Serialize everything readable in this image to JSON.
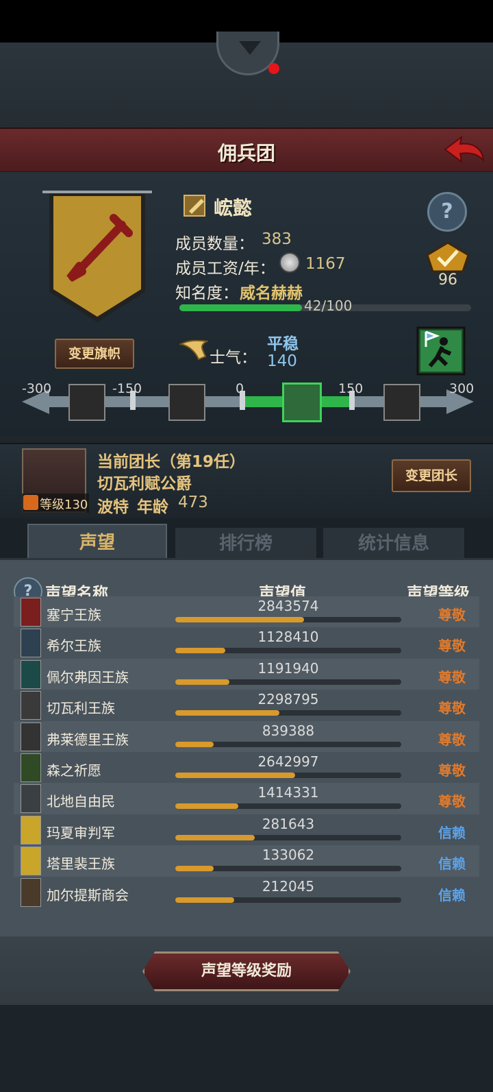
{
  "header": {
    "title": "佣兵团"
  },
  "guild": {
    "name": "峵懿",
    "members_label": "成员数量：",
    "members": "383",
    "wage_label": "成员工资/年：",
    "wage": "1167",
    "fame_label": "知名度：",
    "fame_title": "威名赫赫",
    "fame_progress": "42/100",
    "fame_fraction": 0.42,
    "badge_value": "96",
    "change_flag_label": "变更旗帜"
  },
  "morale": {
    "label": "士气：",
    "state": "平稳",
    "value": "140",
    "scale_ticks": [
      "-300",
      "-150",
      "0",
      "150",
      "300"
    ]
  },
  "leader": {
    "title": "当前团长（第19任）",
    "name": "切瓦利赋公爵",
    "level": "等级130",
    "race": "波特",
    "age_label": "年龄",
    "age": "473",
    "change_label": "变更团长"
  },
  "tabs": {
    "reputation": "声望",
    "ranking": "排行榜",
    "stats": "统计信息"
  },
  "columns": {
    "name": "声望名称",
    "value": "声望值",
    "level": "声望等级"
  },
  "rows": [
    {
      "name": "塞宁王族",
      "value": "2843574",
      "fill": 0.57,
      "level": "尊敬"
    },
    {
      "name": "希尔王族",
      "value": "1128410",
      "fill": 0.22,
      "level": "尊敬"
    },
    {
      "name": "佩尔弗因王族",
      "value": "1191940",
      "fill": 0.24,
      "level": "尊敬"
    },
    {
      "name": "切瓦利王族",
      "value": "2298795",
      "fill": 0.46,
      "level": "尊敬"
    },
    {
      "name": "弗莱德里王族",
      "value": "839388",
      "fill": 0.17,
      "level": "尊敬"
    },
    {
      "name": "森之祈愿",
      "value": "2642997",
      "fill": 0.53,
      "level": "尊敬"
    },
    {
      "name": "北地自由民",
      "value": "1414331",
      "fill": 0.28,
      "level": "尊敬"
    },
    {
      "name": "玛夏审判军",
      "value": "281643",
      "fill": 0.35,
      "level": "信赖"
    },
    {
      "name": "塔里裴王族",
      "value": "133062",
      "fill": 0.17,
      "level": "信赖"
    },
    {
      "name": "加尔提斯商会",
      "value": "212045",
      "fill": 0.26,
      "level": "信赖"
    }
  ],
  "footer": {
    "reward_label": "声望等级奖励"
  },
  "colors": {
    "respect": "#e07a2c",
    "trust": "#5ba3ea",
    "icon_colors": [
      "#7a1e1e",
      "#2d4150",
      "#1c4a48",
      "#3a3a3a",
      "#333333",
      "#2f4a24",
      "#3a3f44",
      "#c9a52a",
      "#c9a52a",
      "#4a3a2a"
    ]
  }
}
